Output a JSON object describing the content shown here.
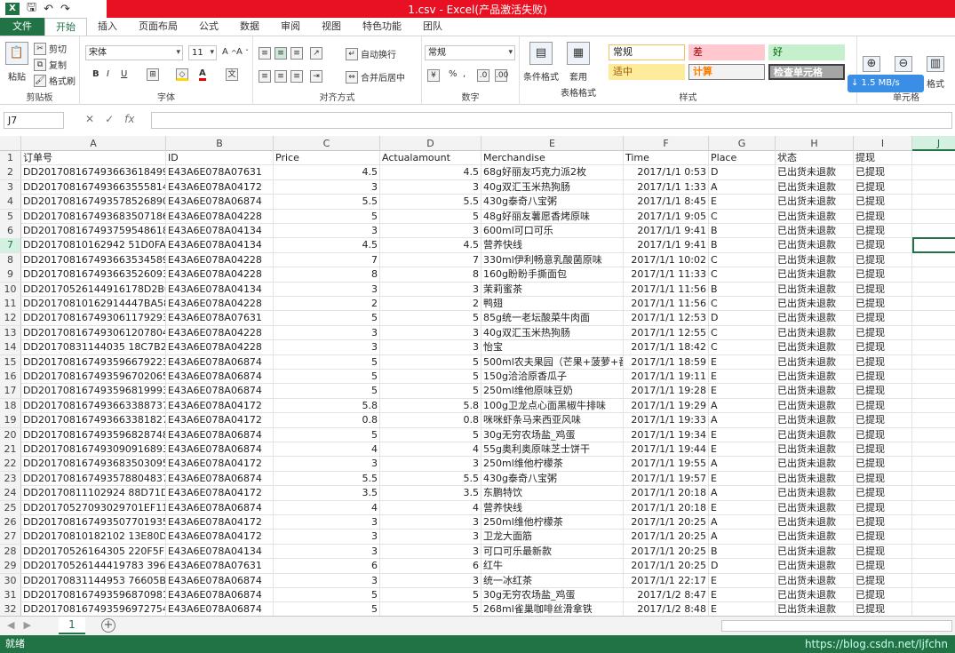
{
  "window": {
    "title": "1.csv - Excel(产品激活失败)"
  },
  "tabs": [
    "文件",
    "开始",
    "插入",
    "页面布局",
    "公式",
    "数据",
    "审阅",
    "视图",
    "特色功能",
    "团队"
  ],
  "ribbon": {
    "clipboard": {
      "label": "剪贴板",
      "paste": "粘贴",
      "cut": "剪切",
      "copy": "复制",
      "format_painter": "格式刷"
    },
    "font": {
      "label": "字体",
      "name": "宋体",
      "size": "11",
      "bold": "B",
      "italic": "I",
      "underline": "U"
    },
    "alignment": {
      "label": "对齐方式",
      "wrap": "自动换行",
      "merge": "合并后居中"
    },
    "number": {
      "label": "数字",
      "format": "常规",
      "percent": "%"
    },
    "styles": {
      "label": "样式",
      "conditional": "条件格式",
      "table_format_1": "套用",
      "table_format_2": "表格格式",
      "cells": [
        "常规",
        "差",
        "好",
        "适中",
        "计算",
        "检查单元格"
      ]
    },
    "cells_group": {
      "label": "单元格",
      "insert": "插入",
      "delete": "删除",
      "format": "格式"
    },
    "net_speed": "↓ 1.5 MB/s"
  },
  "formula_bar": {
    "name_box": "J7",
    "formula": ""
  },
  "columns": [
    "A",
    "B",
    "C",
    "D",
    "E",
    "F",
    "G",
    "H",
    "I",
    "J"
  ],
  "selected_column": "J",
  "selected_row": 7,
  "rows": [
    [
      "订单号",
      "ID",
      "Price",
      "Actualamount",
      "Merchandise",
      "Time",
      "Place",
      "状态",
      "提现"
    ],
    [
      "DD201708167493663618499909",
      "E43A6E078A07631",
      "4.5",
      "4.5",
      "68g好丽友巧克力派2枚",
      "2017/1/1 0:53",
      "D",
      "已出货未退款",
      "已提现"
    ],
    [
      "DD201708167493663555814061",
      "E43A6E078A04172",
      "3",
      "3",
      "40g双汇玉米热狗肠",
      "2017/1/1 1:33",
      "A",
      "已出货未退款",
      "已提现"
    ],
    [
      "DD201708167493578526890939",
      "E43A6E078A06874",
      "5.5",
      "5.5",
      "430g泰奇八宝粥",
      "2017/1/1 8:45",
      "E",
      "已出货未退款",
      "已提现"
    ],
    [
      "DD201708167493683507186615",
      "E43A6E078A04228",
      "5",
      "5",
      "48g好丽友薯愿香烤原味",
      "2017/1/1 9:05",
      "C",
      "已出货未退款",
      "已提现"
    ],
    [
      "DD201708167493759548618252",
      "E43A6E078A04134",
      "3",
      "3",
      "600ml可口可乐",
      "2017/1/1 9:41",
      "B",
      "已出货未退款",
      "已提现"
    ],
    [
      "DD20170810162942 51D0FA5D31",
      "E43A6E078A04134",
      "4.5",
      "4.5",
      "营养快线",
      "2017/1/1 9:41",
      "B",
      "已出货未退款",
      "已提现"
    ],
    [
      "DD201708167493663534589050",
      "E43A6E078A04228",
      "7",
      "7",
      "330ml伊利畅意乳酸菌原味",
      "2017/1/1 10:02",
      "C",
      "已出货未退款",
      "已提现"
    ],
    [
      "DD201708167493663526093267",
      "E43A6E078A04228",
      "8",
      "8",
      "160g盼盼手撕面包",
      "2017/1/1 11:33",
      "C",
      "已出货未退款",
      "已提现"
    ],
    [
      "DD20170526144916178D2B0429",
      "E43A6E078A04134",
      "3",
      "3",
      "茉莉蜜茶",
      "2017/1/1 11:56",
      "B",
      "已出货未退款",
      "已提现"
    ],
    [
      "DD20170810162914447BA58EF3",
      "E43A6E078A04228",
      "2",
      "2",
      "鸭翅",
      "2017/1/1 11:56",
      "C",
      "已出货未退款",
      "已提现"
    ],
    [
      "DD201708167493061179293730",
      "E43A6E078A07631",
      "5",
      "5",
      "85g统一老坛酸菜牛肉面",
      "2017/1/1 12:53",
      "D",
      "已出货未退款",
      "已提现"
    ],
    [
      "DD201708167493061207804487",
      "E43A6E078A04228",
      "3",
      "3",
      "40g双汇玉米热狗肠",
      "2017/1/1 12:55",
      "C",
      "已出货未退款",
      "已提现"
    ],
    [
      "DD20170831144035 18C7B2A1F9",
      "E43A6E078A04228",
      "3",
      "3",
      "怡宝",
      "2017/1/1 18:42",
      "C",
      "已出货未退款",
      "已提现"
    ],
    [
      "DD201708167493596679223858",
      "E43A6E078A06874",
      "5",
      "5",
      "500ml农夫果园（芒果+菠萝+番",
      "2017/1/1 18:59",
      "E",
      "已出货未退款",
      "已提现"
    ],
    [
      "DD201708167493596702065938",
      "E43A6E078A06874",
      "5",
      "5",
      "150g洽洽原香瓜子",
      "2017/1/1 19:11",
      "E",
      "已出货未退款",
      "已提现"
    ],
    [
      "DD201708167493596819993334",
      "E43A6E078A06874",
      "5",
      "5",
      "250ml维他原味豆奶",
      "2017/1/1 19:28",
      "E",
      "已出货未退款",
      "已提现"
    ],
    [
      "DD201708167493663388737478",
      "E43A6E078A04172",
      "5.8",
      "5.8",
      "100g卫龙点心面黑椒牛排味",
      "2017/1/1 19:29",
      "A",
      "已出货未退款",
      "已提现"
    ],
    [
      "DD201708167493663381827746",
      "E43A6E078A04172",
      "0.8",
      "0.8",
      "咪咪虾条马来西亚风味",
      "2017/1/1 19:33",
      "A",
      "已出货未退款",
      "已提现"
    ],
    [
      "DD201708167493596828748693",
      "E43A6E078A06874",
      "5",
      "5",
      "30g无穷农场盐_鸡蛋",
      "2017/1/1 19:34",
      "E",
      "已出货未退款",
      "已提现"
    ],
    [
      "DD201708167493090916893968",
      "E43A6E078A06874",
      "4",
      "4",
      "55g奥利奥原味芝士饼干",
      "2017/1/1 19:44",
      "E",
      "已出货未退款",
      "已提现"
    ],
    [
      "DD201708167493683503095993",
      "E43A6E078A04172",
      "3",
      "3",
      "250ml维他柠檬茶",
      "2017/1/1 19:55",
      "A",
      "已出货未退款",
      "已提现"
    ],
    [
      "DD201708167493578804837461",
      "E43A6E078A06874",
      "5.5",
      "5.5",
      "430g泰奇八宝粥",
      "2017/1/1 19:57",
      "E",
      "已出货未退款",
      "已提现"
    ],
    [
      "DD20170811102924 88D71D623E",
      "E43A6E078A04172",
      "3.5",
      "3.5",
      "东鹏特饮",
      "2017/1/1 20:18",
      "A",
      "已出货未退款",
      "已提现"
    ],
    [
      "DD20170527093029701EF116F5",
      "E43A6E078A06874",
      "4",
      "4",
      "营养快线",
      "2017/1/1 20:18",
      "E",
      "已出货未退款",
      "已提现"
    ],
    [
      "DD201708167493507701935975",
      "E43A6E078A04172",
      "3",
      "3",
      "250ml维他柠檬茶",
      "2017/1/1 20:25",
      "A",
      "已出货未退款",
      "已提现"
    ],
    [
      "DD20170810182102 13E80D235B",
      "E43A6E078A04172",
      "3",
      "3",
      "卫龙大面筋",
      "2017/1/1 20:25",
      "A",
      "已出货未退款",
      "已提现"
    ],
    [
      "DD20170526164305 220F5FD19C",
      "E43A6E078A04134",
      "3",
      "3",
      "可口可乐最新款",
      "2017/1/1 20:25",
      "B",
      "已出货未退款",
      "已提现"
    ],
    [
      "DD20170526144419783 3969DB2",
      "E43A6E078A07631",
      "6",
      "6",
      "红牛",
      "2017/1/1 20:25",
      "D",
      "已出货未退款",
      "已提现"
    ],
    [
      "DD20170831144953 76605B3DD9",
      "E43A6E078A06874",
      "3",
      "3",
      "统一冰红茶",
      "2017/1/1 22:17",
      "E",
      "已出货未退款",
      "已提现"
    ],
    [
      "DD201708167493596870981677",
      "E43A6E078A06874",
      "5",
      "5",
      "30g无穷农场盐_鸡蛋",
      "2017/1/2 8:47",
      "E",
      "已出货未退款",
      "已提现"
    ],
    [
      "DD201708167493596972754353",
      "E43A6E078A06874",
      "5",
      "5",
      "268ml雀巢咖啡丝滑拿铁",
      "2017/1/2 8:48",
      "E",
      "已出货未退款",
      "已提现"
    ]
  ],
  "sheet_tabs": [
    "1"
  ],
  "status": {
    "text": "就绪",
    "watermark": "https://blog.csdn.net/ljfchn"
  }
}
